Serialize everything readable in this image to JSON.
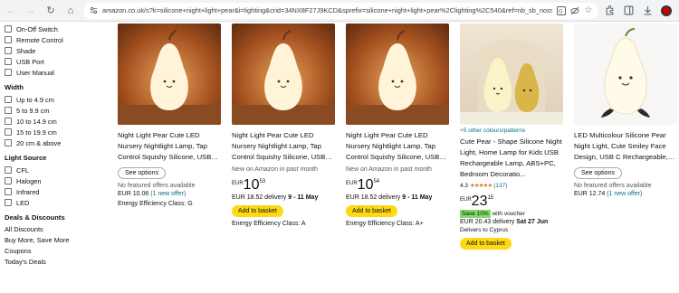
{
  "browser": {
    "url": "amazon.co.uk/s?k=silicone+night+light+pear&i=lighting&crid=34NX8F27J9KCD&sprefix=silicone+night+light+pear%2Clighting%2C540&ref=nb_sb_noss"
  },
  "sidebar": {
    "features": [
      "On-Off Switch",
      "Remote Control",
      "Shade",
      "USB Port",
      "User Manual"
    ],
    "width_heading": "Width",
    "widths": [
      "Up to 4.9 cm",
      "5 to 9.9 cm",
      "10 to 14.9 cm",
      "15 to 19.9 cm",
      "20 cm & above"
    ],
    "light_source_heading": "Light Source",
    "light_sources": [
      "CFL",
      "Halogen",
      "Infrared",
      "LED"
    ],
    "deals_heading": "Deals & Discounts",
    "deals": [
      "All Discounts",
      "Buy More, Save More",
      "Coupons",
      "Today's Deals"
    ]
  },
  "products": [
    {
      "title": "Night Light Pear Cute LED Nursery Nightlight Lamp, Tap Control Squishy Silicone, USB Rechargeable Bedside Lamp...",
      "see_options": "See options",
      "no_offers": "No featured offers available",
      "price_text": "EUR 10.06",
      "new_offer": "(1 new offer)",
      "energy": "Energy Efficiency Class: G"
    },
    {
      "title": "Night Light Pear Cute LED Nursery Nightlight Lamp, Tap Control Squishy Silicone, USB Rechargeable Bedside Lamp...",
      "subtext": "New on Amazon in past month",
      "currency": "EUR",
      "whole": "10",
      "frac": "53",
      "delivery_prefix": "EUR 18.52 delivery",
      "delivery_date": "9 - 11 May",
      "basket": "Add to basket",
      "energy": "Energy Efficiency Class: A"
    },
    {
      "title": "Night Light Pear Cute LED Nursery Nightlight Lamp, Tap Control Squishy Silicone, USB Rechargeable Bedside Lamp...",
      "subtext": "New on Amazon in past month",
      "currency": "EUR",
      "whole": "10",
      "frac": "54",
      "delivery_prefix": "EUR 18.52 delivery",
      "delivery_date": "9 - 11 May",
      "basket": "Add to basket",
      "energy": "Energy Efficiency Class: A+"
    },
    {
      "colours": "+5 other colours/patterns",
      "title": "Cute Pear - Shape Silicone Night Light, Home Lamp for Kids USB Rechargeable Lamp, ABS+PC, Bedroom Decoratio...",
      "rating_value": "4.3",
      "stars": "★★★★★",
      "rating_count": "(137)",
      "currency": "EUR",
      "whole": "23",
      "frac": "15",
      "save_badge": "Save 10%",
      "save_suffix": "with voucher",
      "delivery_prefix": "EUR 20.43 delivery",
      "delivery_date": "Sat 27 Jun",
      "delivers_to": "Delivers to Cyprus",
      "basket": "Add to basket"
    },
    {
      "title": "LED Multicolour Silicone Pear Night Light, Cute Smiley Face Design, USB C Rechargeable, Bedside Lamp for Kids",
      "see_options": "See options",
      "no_offers": "No featured offers available",
      "price_text": "EUR 12.74",
      "new_offer": "(1 new offer)"
    }
  ]
}
